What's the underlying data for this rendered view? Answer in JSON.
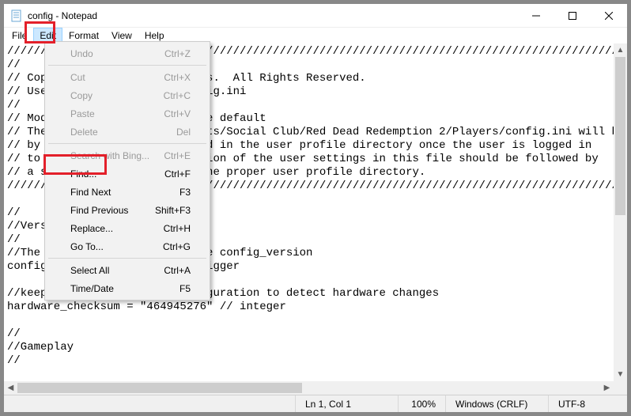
{
  "window": {
    "title": "config - Notepad"
  },
  "menubar": {
    "items": [
      "File",
      "Edit",
      "Format",
      "View",
      "Help"
    ]
  },
  "edit_menu": {
    "items": [
      {
        "label": "Undo",
        "shortcut": "Ctrl+Z",
        "enabled": false
      },
      {
        "sep": true
      },
      {
        "label": "Cut",
        "shortcut": "Ctrl+X",
        "enabled": false
      },
      {
        "label": "Copy",
        "shortcut": "Ctrl+C",
        "enabled": false
      },
      {
        "label": "Paste",
        "shortcut": "Ctrl+V",
        "enabled": false
      },
      {
        "label": "Delete",
        "shortcut": "Del",
        "enabled": false
      },
      {
        "sep": true
      },
      {
        "label": "Search with Bing...",
        "shortcut": "Ctrl+E",
        "enabled": false
      },
      {
        "label": "Find...",
        "shortcut": "Ctrl+F",
        "enabled": true
      },
      {
        "label": "Find Next",
        "shortcut": "F3",
        "enabled": true
      },
      {
        "label": "Find Previous",
        "shortcut": "Shift+F3",
        "enabled": true
      },
      {
        "label": "Replace...",
        "shortcut": "Ctrl+H",
        "enabled": true
      },
      {
        "label": "Go To...",
        "shortcut": "Ctrl+G",
        "enabled": true
      },
      {
        "sep": true
      },
      {
        "label": "Select All",
        "shortcut": "Ctrl+A",
        "enabled": true
      },
      {
        "label": "Time/Date",
        "shortcut": "F5",
        "enabled": true
      }
    ]
  },
  "editor_text": "//////////////////////////////////////////////////////////////////////////////////////////////\n//\n// Copyright (C) Rockstar Games.  All Rights Reserved.\n// User Settings saved to config.ini\n//\n// Modifying this file over the default\n// The Config found at Documents/Social Club/Red Dead Redemption 2/Players/config.ini will be applied on boot and will be overridden.\n// by any Config settings found in the user profile directory once the user is logged in\n// to their profile. Modification of the user settings in this file should be followed by\n// a similar modification in the proper user profile directory.\n//////////////////////////////////////////////////////////////////////////////////////////////\n\n//\n//Version\n//\n//The first setting needs to be config_version\nconfig_version = \"7\" // 0 or bigger\n\n//keep track of hardware configuration to detect hardware changes\nhardware_checksum = \"464945276\" // integer\n\n//\n//Gameplay\n//",
  "status": {
    "position": "Ln 1, Col 1",
    "zoom": "100%",
    "line_ending": "Windows (CRLF)",
    "encoding": "UTF-8"
  }
}
